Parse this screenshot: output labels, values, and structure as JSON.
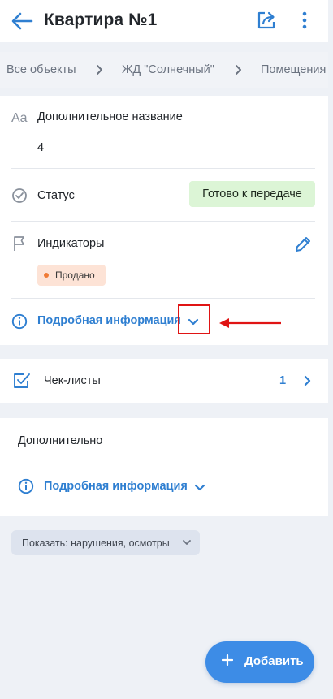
{
  "header": {
    "title": "Квартира №1"
  },
  "breadcrumb": {
    "items": [
      "Все объекты",
      "ЖД \"Солнечный\"",
      "Помещения"
    ]
  },
  "main": {
    "extra_name_label": "Дополнительное название",
    "extra_name_value": "4",
    "status_label": "Статус",
    "status_value": "Готово к передаче",
    "indicators_label": "Индикаторы",
    "indicator_tag": "Продано",
    "details_link": "Подробная информация"
  },
  "checklists": {
    "label": "Чек-листы",
    "count": "1"
  },
  "extra": {
    "title": "Дополнительно",
    "details_link": "Подробная информация"
  },
  "filter": {
    "label": "Показать: нарушения, осмотры"
  },
  "fab": {
    "label": "Добавить"
  },
  "colors": {
    "accent": "#2f7fd1",
    "status_bg": "#dcf5d6",
    "tag_bg": "#fde3d6",
    "tag_dot": "#f07a35",
    "annotation_red": "#e01414",
    "fab_bg": "#3d8ce6"
  },
  "icons": {
    "back": "arrow-left-icon",
    "share": "share-icon",
    "more": "more-vertical-icon",
    "text_format": "text-format-icon",
    "status": "check-circle-icon",
    "indicators": "flag-icon",
    "edit": "pencil-icon",
    "info": "info-icon",
    "checklist": "checkbox-icon",
    "chevron": "chevron-icon"
  }
}
